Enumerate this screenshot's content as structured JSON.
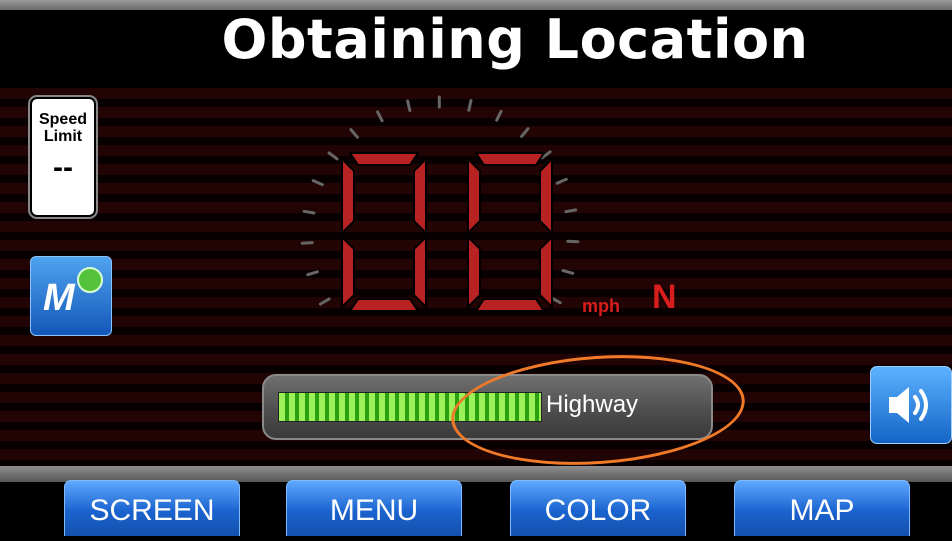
{
  "title": "Obtaining Location",
  "speed_limit": {
    "label": "Speed Limit",
    "value": "--"
  },
  "speed": {
    "digits": "00",
    "unit": "mph",
    "heading": "N"
  },
  "road": {
    "type": "Highway"
  },
  "tabs": [
    "SCREEN",
    "MENU",
    "COLOR",
    "MAP"
  ],
  "colors": {
    "accent_red": "#d81d1d",
    "button_blue": "#1a63cf",
    "signal_green": "#2aa00f",
    "highlight_orange": "#f07a28"
  },
  "icons": {
    "app": "m-check-icon",
    "sound": "speaker-icon"
  }
}
